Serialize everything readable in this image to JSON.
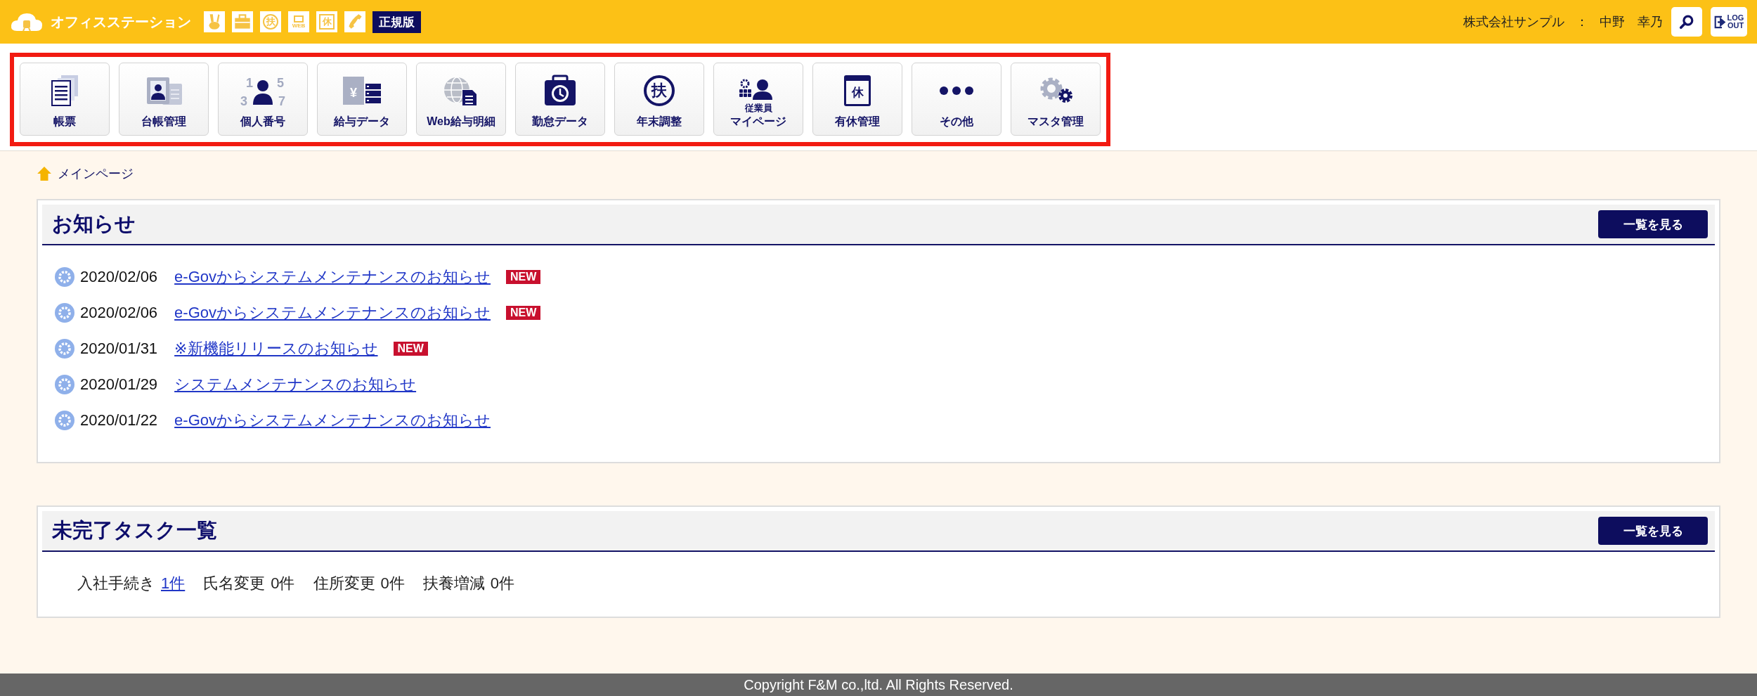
{
  "header": {
    "app_name": "オフィスステーション",
    "quick_links": [
      {
        "kind": "rabbit"
      },
      {
        "kind": "briefcase"
      },
      {
        "kind": "seal",
        "glyph": "扶"
      },
      {
        "kind": "web",
        "glyph": "WEB"
      },
      {
        "kind": "box",
        "glyph": "休"
      },
      {
        "kind": "phone"
      }
    ],
    "edition_badge": "正規版",
    "company": "株式会社サンプル",
    "separator": "：",
    "user_name": "中野　幸乃",
    "logout_label": [
      "LOG",
      "OUT"
    ]
  },
  "toolbar": [
    {
      "label": "帳票",
      "kind": "document"
    },
    {
      "label": "台帳管理",
      "kind": "card"
    },
    {
      "label": "個人番号",
      "kind": "numbers",
      "glyphs": [
        "1",
        "5",
        "3",
        "7"
      ]
    },
    {
      "label": "給与データ",
      "kind": "envelope",
      "glyph": "¥"
    },
    {
      "label": "Web給与明細",
      "kind": "globe"
    },
    {
      "label": "勤怠データ",
      "kind": "clock"
    },
    {
      "label": "年末調整",
      "kind": "seal",
      "glyph": "扶"
    },
    {
      "sublabel": "従業員",
      "label": "マイページ",
      "kind": "person"
    },
    {
      "label": "有休管理",
      "kind": "calendar",
      "glyph": "休"
    },
    {
      "label": "その他",
      "kind": "dots"
    },
    {
      "label": "マスタ管理",
      "kind": "gears"
    }
  ],
  "breadcrumb": "メインページ",
  "notices": {
    "title": "お知らせ",
    "more_button": "一覧を見る",
    "items": [
      {
        "date": "2020/02/06",
        "title": "e-Govからシステムメンテナンスのお知らせ",
        "badge": "NEW"
      },
      {
        "date": "2020/02/06",
        "title": "e-Govからシステムメンテナンスのお知らせ",
        "badge": "NEW"
      },
      {
        "date": "2020/01/31",
        "title": "※新機能リリースのお知らせ",
        "badge": "NEW"
      },
      {
        "date": "2020/01/29",
        "title": "システムメンテナンスのお知らせ"
      },
      {
        "date": "2020/01/22",
        "title": "e-Govからシステムメンテナンスのお知らせ"
      }
    ]
  },
  "tasks": {
    "title": "未完了タスク一覧",
    "more_button": "一覧を見る",
    "items": [
      {
        "label": "入社手続き",
        "count": "1件",
        "link": true
      },
      {
        "label": "氏名変更",
        "count": "0件",
        "link": false
      },
      {
        "label": "住所変更",
        "count": "0件",
        "link": false
      },
      {
        "label": "扶養増減",
        "count": "0件",
        "link": false
      }
    ]
  },
  "footer": "Copyright F&M co.,ltd. All Rights Reserved."
}
